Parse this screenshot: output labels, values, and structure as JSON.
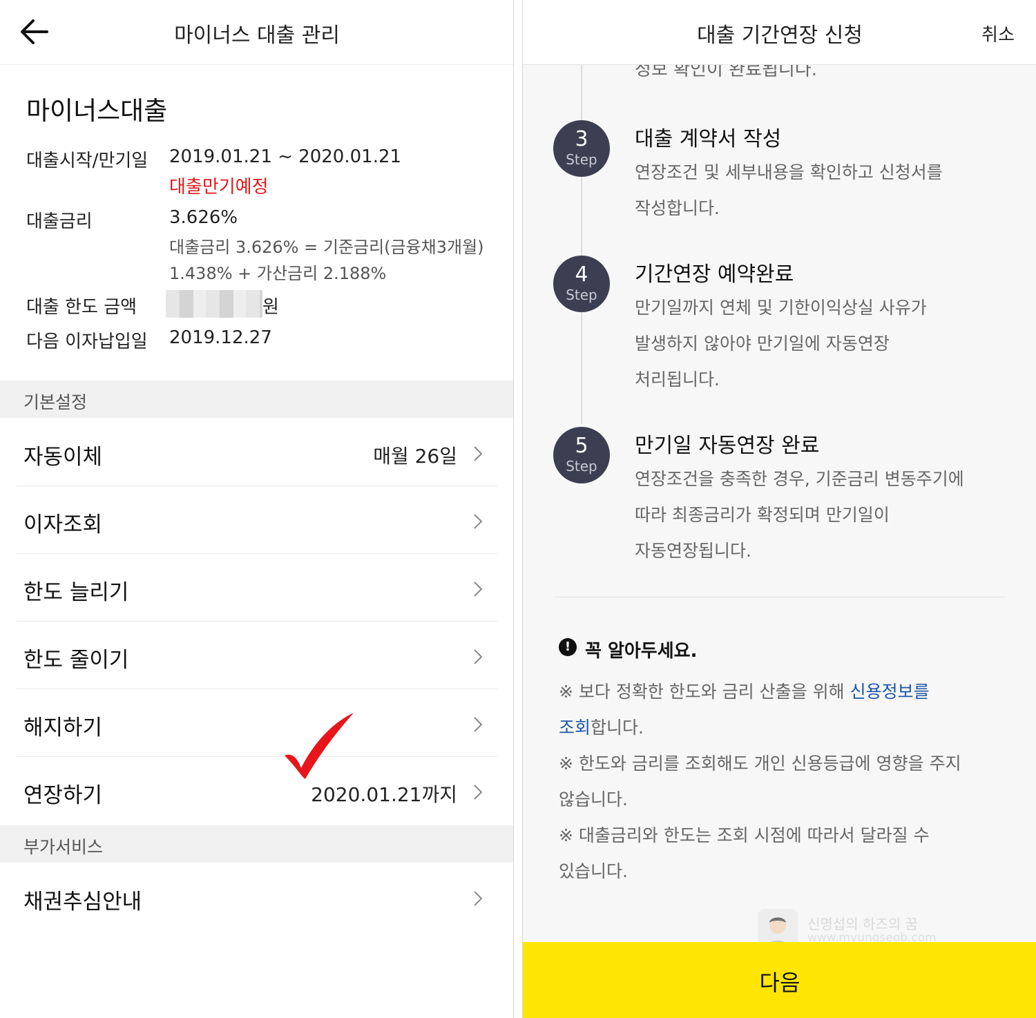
{
  "left": {
    "header": {
      "title": "마이너스 대출 관리",
      "back_icon": "arrow-left-icon"
    },
    "loan_name": "마이너스대출",
    "info": {
      "period_label": "대출시작/만기일",
      "period_value": "2019.01.21 ~ 2020.01.21",
      "period_status": "대출만기예정",
      "rate_label": "대출금리",
      "rate_value": "3.626%",
      "rate_detail_1": "대출금리 3.626% = 기준금리(금융채3개월)",
      "rate_detail_2": "1.438% + 가산금리 2.188%",
      "limit_label": "대출 한도 금액",
      "limit_unit": "원",
      "next_interest_label": "다음 이자납입일",
      "next_interest_value": "2019.12.27"
    },
    "sections": {
      "basic": "기본설정",
      "extra": "부가서비스"
    },
    "menu": [
      {
        "label": "자동이체",
        "value": "매월 26일"
      },
      {
        "label": "이자조회",
        "value": ""
      },
      {
        "label": "한도 늘리기",
        "value": ""
      },
      {
        "label": "한도 줄이기",
        "value": ""
      },
      {
        "label": "해지하기",
        "value": ""
      },
      {
        "label": "연장하기",
        "value": "2020.01.21까지"
      }
    ],
    "extra_menu": [
      {
        "label": "채권추심안내"
      }
    ],
    "colors": {
      "alert_red": "#e01818",
      "check_red": "#e8151b"
    }
  },
  "right": {
    "header": {
      "title": "대출 기간연장 신청",
      "cancel": "취소"
    },
    "cut_text": "정보 확인이 완료됩니다.",
    "step_word": "Step",
    "steps": [
      {
        "num": "3",
        "title": "대출 계약서 작성",
        "desc": [
          "연장조건 및 세부내용을 확인하고 신청서를",
          "작성합니다."
        ]
      },
      {
        "num": "4",
        "title": "기간연장 예약완료",
        "desc": [
          "만기일까지 연체 및 기한이익상실 사유가",
          "발생하지 않아야 만기일에 자동연장",
          "처리됩니다."
        ]
      },
      {
        "num": "5",
        "title": "만기일 자동연장 완료",
        "desc": [
          "연장조건을 충족한 경우, 기준금리 변동주기에",
          "따라 최종금리가 확정되며 만기일이",
          "자동연장됩니다."
        ]
      }
    ],
    "notice": {
      "icon": "exclamation-icon",
      "title": "꼭 알아두세요.",
      "line1_pre": "※ 보다 정확한 한도와 금리 산출을 위해 ",
      "line1_link": "신용정보를",
      "line2_link": "조회",
      "line2_post": "합니다.",
      "line3": "※ 한도와 금리를 조회해도 개인 신용등급에 영향을 주지",
      "line4": "않습니다.",
      "line5": "※ 대출금리와 한도는 조회 시점에 따라서 달라질 수",
      "line6": "있습니다."
    },
    "watermark": {
      "name": "신명섭의 하즈의 꿈",
      "url": "www.myungseob.com"
    },
    "next_button": "다음",
    "colors": {
      "button_yellow": "#ffe502",
      "step_circle": "#3c3f52",
      "link_blue": "#1a56a8"
    }
  }
}
